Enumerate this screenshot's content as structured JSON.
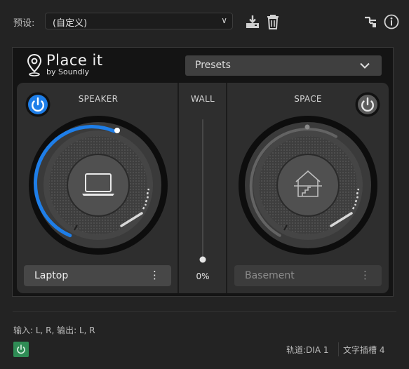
{
  "host": {
    "preset_label": "预设:",
    "preset_value": "(自定义)",
    "icons": [
      "save-icon",
      "trash-icon",
      "routing-icon",
      "info-icon"
    ]
  },
  "plugin": {
    "logo": {
      "name": "Place it",
      "sub": "by Soundly"
    },
    "presets_label": "Presets",
    "speaker": {
      "title": "SPEAKER",
      "power_on": true,
      "source": "Laptop",
      "knob_level": 0.62,
      "icon": "laptop-icon"
    },
    "wall": {
      "title": "WALL",
      "value": "0%",
      "level": 0
    },
    "space": {
      "title": "SPACE",
      "power_on": false,
      "source": "Basement",
      "knob_level": 0.0,
      "icon": "house-basement-icon"
    },
    "colors": {
      "accent": "#1e7ee8",
      "bypass": "#2f8c55"
    }
  },
  "footer": {
    "io": "输入: L, R, 输出: L, R",
    "track": "轨道:DIA 1",
    "slot": "文字插槽 4"
  }
}
